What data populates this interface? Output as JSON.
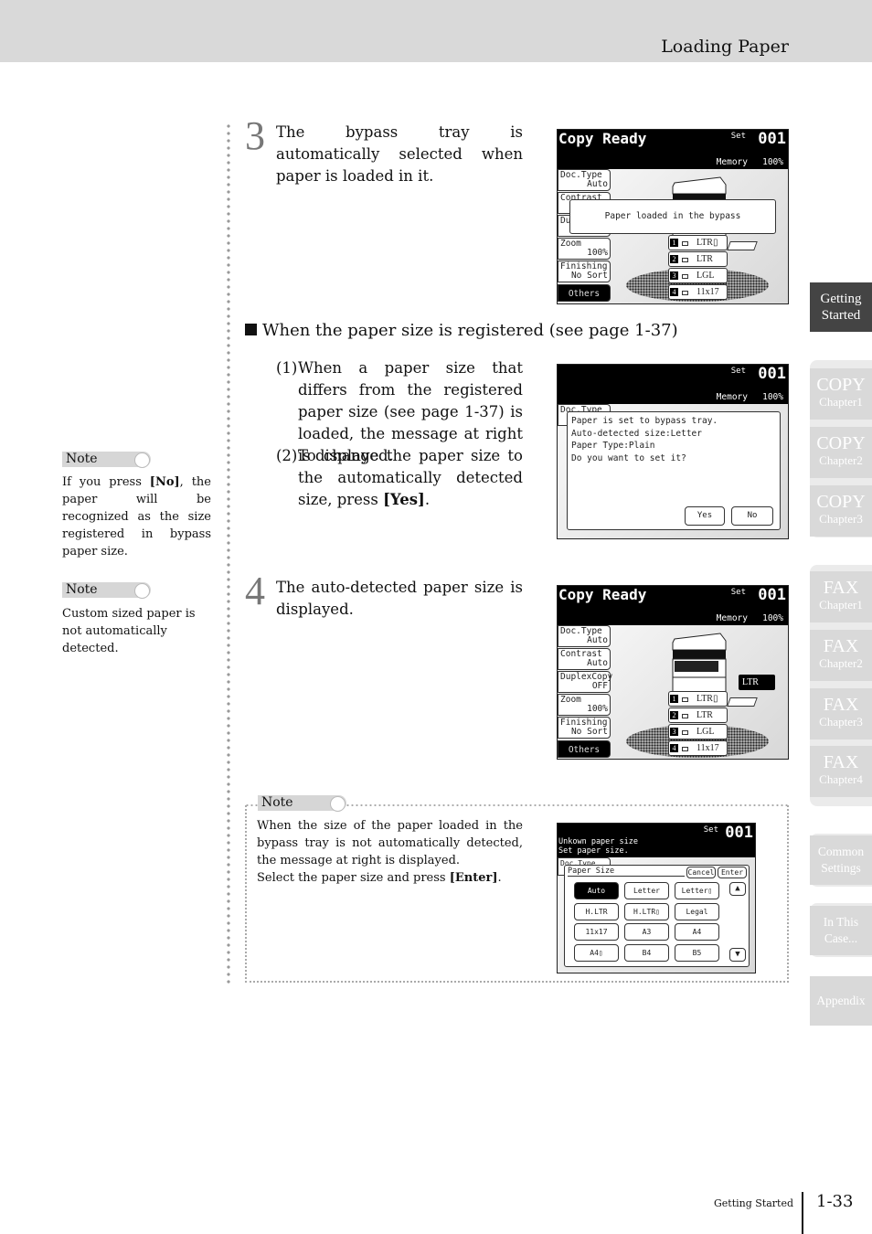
{
  "header": {
    "title": "Loading Paper"
  },
  "step3": {
    "number": "3",
    "text": "The bypass tray is automatically selected when paper is loaded in it."
  },
  "subhead": "When the paper size is registered (see page 1-37)",
  "items": [
    {
      "num": "(1)",
      "pre": "When a paper size that differs from the registered paper size (see page 1-37) is loaded, the message at right is displayed.",
      "bold": "",
      "post": ""
    },
    {
      "num": "(2)",
      "pre": "To change the paper size to the automatically detected size, press ",
      "bold": "[Yes]",
      "post": "."
    }
  ],
  "step4": {
    "number": "4",
    "text": "The auto-detected paper size is displayed."
  },
  "notes": [
    {
      "label": "Note",
      "pre": "If you press ",
      "bold": "[No]",
      "post": ", the paper will be recognized as the size registered in bypass paper size."
    },
    {
      "label": "Note",
      "pre": "Custom sized paper is not automatically detected.",
      "bold": "",
      "post": ""
    },
    {
      "label": "Note",
      "pre": "When the size of the paper loaded in the bypass tray is not automatically detected, the message at right is displayed.\nSelect the paper size and press ",
      "bold": "[Enter]",
      "post": "."
    }
  ],
  "screens": [
    {
      "title": "Copy Ready",
      "set_label": "Set",
      "set_value": "001",
      "memory_label": "Memory",
      "memory_value": "100%",
      "left_buttons": [
        {
          "label": "Doc.Type",
          "value": "Auto"
        },
        {
          "label": "Contrast",
          "value": ""
        },
        {
          "label": "Du",
          "value": ""
        },
        {
          "label": "Zoom",
          "value": "100%"
        },
        {
          "label": "Finishing",
          "value": "No Sort"
        }
      ],
      "others": "Others",
      "trays": [
        {
          "num": "1",
          "size": "LTR▯"
        },
        {
          "num": "2",
          "size": "LTR"
        },
        {
          "num": "3",
          "size": "LGL"
        },
        {
          "num": "4",
          "size": "11x17"
        }
      ],
      "overlay": "Paper loaded in the bypass"
    },
    {
      "title": "",
      "set_label": "Set",
      "set_value": "001",
      "memory_label": "Memory",
      "memory_value": "100%",
      "left_buttons": [
        {
          "label": "Doc.Type",
          "value": ""
        }
      ],
      "dialog_lines": [
        "Paper is set to bypass tray.",
        "Auto-detected size:Letter",
        "Paper Type:Plain",
        "Do you want to set it?"
      ],
      "yes": "Yes",
      "no": "No"
    },
    {
      "title": "Copy Ready",
      "set_label": "Set",
      "set_value": "001",
      "memory_label": "Memory",
      "memory_value": "100%",
      "left_buttons": [
        {
          "label": "Doc.Type",
          "value": "Auto"
        },
        {
          "label": "Contrast",
          "value": "Auto"
        },
        {
          "label": "DuplexCopy",
          "value": "OFF"
        },
        {
          "label": "Zoom",
          "value": "100%"
        },
        {
          "label": "Finishing",
          "value": "No Sort"
        }
      ],
      "others": "Others",
      "trays": [
        {
          "num": "1",
          "size": "LTR▯"
        },
        {
          "num": "2",
          "size": "LTR"
        },
        {
          "num": "3",
          "size": "LGL"
        },
        {
          "num": "4",
          "size": "11x17"
        }
      ],
      "detected": "LTR"
    },
    {
      "set_label": "Set",
      "set_value": "001",
      "messages": [
        "Unkown paper size",
        "Set paper size."
      ],
      "left_buttons": [
        {
          "label": "Doc.Type",
          "value": ""
        }
      ],
      "panel_title": "Paper Size",
      "cancel": "Cancel",
      "enter": "Enter",
      "sizes": [
        "Auto",
        "Letter",
        "Letter▯",
        "H.LTR",
        "H.LTR▯",
        "Legal",
        "11x17",
        "A3",
        "A4",
        "A4▯",
        "B4",
        "B5"
      ],
      "selected": "Auto"
    }
  ],
  "side_tabs": [
    {
      "big": "Getting",
      "small": "Started",
      "active": true
    },
    {
      "big": "COPY",
      "small": "Chapter1"
    },
    {
      "big": "COPY",
      "small": "Chapter2"
    },
    {
      "big": "COPY",
      "small": "Chapter3"
    },
    {
      "big": "FAX",
      "small": "Chapter1"
    },
    {
      "big": "FAX",
      "small": "Chapter2"
    },
    {
      "big": "FAX",
      "small": "Chapter3"
    },
    {
      "big": "FAX",
      "small": "Chapter4"
    },
    {
      "big": "Common",
      "small": "Settings"
    },
    {
      "big": "In This",
      "small": "Case..."
    },
    {
      "big": "Appendix",
      "small": ""
    }
  ],
  "footer": {
    "section": "Getting Started",
    "page": "1-33"
  }
}
